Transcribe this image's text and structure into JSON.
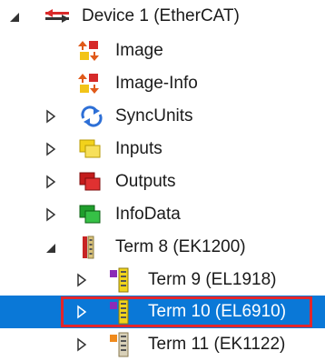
{
  "tree": {
    "nodes": [
      {
        "id": "device-1",
        "label": "Device 1 (EtherCAT)",
        "icon": "ethercat-device-icon",
        "expander": "expanded"
      },
      {
        "id": "image",
        "label": "Image",
        "icon": "image-icon",
        "expander": "none"
      },
      {
        "id": "image-info",
        "label": "Image-Info",
        "icon": "image-icon",
        "expander": "none"
      },
      {
        "id": "syncunits",
        "label": "SyncUnits",
        "icon": "sync-arrows-icon",
        "expander": "collapsed"
      },
      {
        "id": "inputs",
        "label": "Inputs",
        "icon": "inputs-folder-icon",
        "expander": "collapsed"
      },
      {
        "id": "outputs",
        "label": "Outputs",
        "icon": "outputs-folder-icon",
        "expander": "collapsed"
      },
      {
        "id": "infodata",
        "label": "InfoData",
        "icon": "infodata-folder-icon",
        "expander": "collapsed"
      },
      {
        "id": "term-8",
        "label": "Term 8 (EK1200)",
        "icon": "coupler-terminal-icon",
        "expander": "expanded"
      },
      {
        "id": "term-9",
        "label": "Term 9 (EL1918)",
        "icon": "terminal-purple-icon",
        "expander": "collapsed"
      },
      {
        "id": "term-10",
        "label": "Term 10 (EL6910)",
        "icon": "terminal-purple-icon",
        "expander": "collapsed",
        "selected": true
      },
      {
        "id": "term-11",
        "label": "Term 11 (EK1122)",
        "icon": "terminal-orange-icon",
        "expander": "collapsed"
      }
    ]
  },
  "colors": {
    "selection": "#0a78d7",
    "highlight_border": "#e2262b"
  }
}
